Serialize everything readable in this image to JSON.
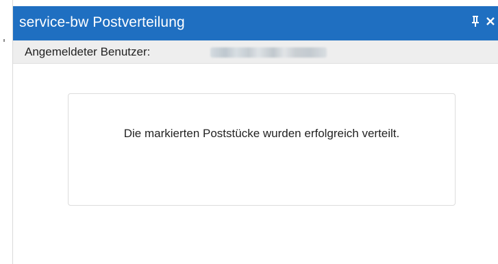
{
  "window": {
    "title": "service-bw Postverteilung",
    "titlebar_color": "#1f6fc1",
    "pin_icon": "pin-icon",
    "close_icon": "close-icon"
  },
  "userbar": {
    "label": "Angemeldeter Benutzer:"
  },
  "message": {
    "text": "Die markierten Poststücke wurden erfolgreich verteilt."
  }
}
